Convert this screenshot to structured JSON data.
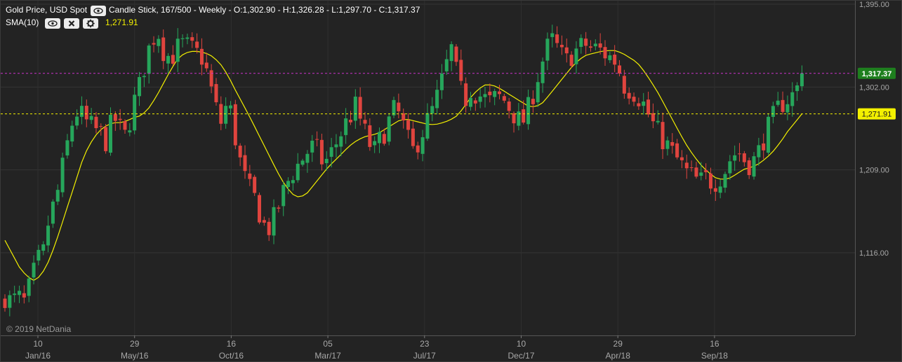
{
  "header": {
    "instrument": "Gold Price, USD Spot",
    "chart_info": "Candle Stick, 167/500 - Weekly - O:1,302.90 - H:1,326.28 - L:1,297.70 - C:1,317.37",
    "indicator_label": "SMA(10)",
    "indicator_value": "1,271.91"
  },
  "icons": [
    "eye-icon",
    "eye-icon",
    "close-icon",
    "gear-icon"
  ],
  "copyright": "© 2019 NetDania",
  "price_labels": {
    "last": "1,317.37",
    "sma": "1,271.91"
  },
  "colors": {
    "background": "#232323",
    "up_candle": "#26a65b",
    "down_candle": "#e0443e",
    "sma_line": "#f3f000",
    "last_price_line": "#cc33cc",
    "sma_price_line": "#f3f000",
    "last_badge": "#1e7f1e",
    "sma_badge": "#f3f000"
  },
  "chart_data": {
    "type": "candlestick",
    "y_ticks": [
      "1,395.00",
      "1,302.00",
      "1,209.00",
      "1,116.00"
    ],
    "x_ticks": [
      {
        "day": "10",
        "month": "Jan/16"
      },
      {
        "day": "29",
        "month": "May/16"
      },
      {
        "day": "16",
        "month": "Oct/16"
      },
      {
        "day": "05",
        "month": "Mar/17"
      },
      {
        "day": "23",
        "month": "Jul/17"
      },
      {
        "day": "10",
        "month": "Dec/17"
      },
      {
        "day": "29",
        "month": "Apr/18"
      },
      {
        "day": "16",
        "month": "Sep/18"
      }
    ],
    "last_close": 1317.37,
    "sma_value": 1271.91,
    "close_path": [
      1068,
      1060,
      1066,
      1060,
      1080,
      1105,
      1115,
      1158,
      1175,
      1210,
      1245,
      1275,
      1270,
      1260,
      1255,
      1250,
      1240,
      1270,
      1255,
      1245,
      1280,
      1300,
      1330,
      1355,
      1365,
      1340,
      1335,
      1345,
      1350,
      1345,
      1340,
      1335,
      1310,
      1280,
      1260,
      1290,
      1250,
      1215,
      1190,
      1180,
      1160,
      1140,
      1150,
      1170,
      1190,
      1205,
      1215,
      1225,
      1235,
      1230,
      1215,
      1225,
      1240,
      1255,
      1268,
      1280,
      1260,
      1240,
      1230,
      1245,
      1260,
      1275,
      1270,
      1245,
      1230,
      1245,
      1260,
      1275,
      1295,
      1320,
      1345,
      1310,
      1285,
      1300,
      1295,
      1290,
      1285,
      1290,
      1290,
      1280,
      1270,
      1260,
      1275,
      1300,
      1325,
      1345,
      1355,
      1340,
      1330,
      1340,
      1345,
      1350,
      1345,
      1345,
      1340,
      1335,
      1330,
      1305,
      1300,
      1295,
      1285,
      1270,
      1255,
      1245,
      1235,
      1225,
      1215,
      1205,
      1200,
      1195,
      1200,
      1195,
      1200,
      1210,
      1225,
      1230,
      1220,
      1215,
      1225,
      1245,
      1260,
      1275,
      1285,
      1290,
      1295,
      1317.37
    ],
    "sma_path": [
      1130,
      1115,
      1100,
      1090,
      1085,
      1090,
      1105,
      1125,
      1150,
      1175,
      1200,
      1225,
      1240,
      1252,
      1258,
      1262,
      1262,
      1264,
      1268,
      1270,
      1278,
      1290,
      1305,
      1320,
      1333,
      1340,
      1342,
      1342,
      1340,
      1336,
      1328,
      1316,
      1300,
      1285,
      1270,
      1254,
      1238,
      1222,
      1206,
      1192,
      1182,
      1178,
      1182,
      1192,
      1202,
      1212,
      1220,
      1228,
      1236,
      1242,
      1246,
      1248,
      1250,
      1255,
      1260,
      1265,
      1266,
      1264,
      1262,
      1260,
      1260,
      1262,
      1265,
      1270,
      1280,
      1292,
      1300,
      1305,
      1304,
      1300,
      1295,
      1290,
      1285,
      1280,
      1280,
      1285,
      1295,
      1305,
      1315,
      1325,
      1333,
      1338,
      1340,
      1342,
      1343,
      1343,
      1340,
      1335,
      1330,
      1320,
      1308,
      1295,
      1280,
      1265,
      1250,
      1236,
      1224,
      1214,
      1206,
      1200,
      1198,
      1200,
      1205,
      1210,
      1212,
      1216,
      1222,
      1230,
      1240,
      1252,
      1262,
      1271.91
    ]
  }
}
